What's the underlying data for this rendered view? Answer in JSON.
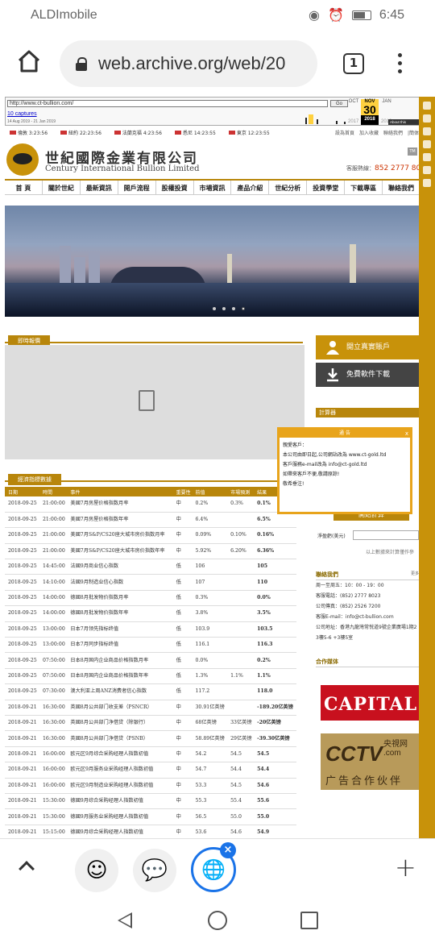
{
  "status": {
    "carrier": "ALDImobile",
    "time": "6:45"
  },
  "browser": {
    "url": "web.archive.org/web/20",
    "tab_count": "1"
  },
  "wayback": {
    "url_value": "http://www.ct-bullion.com/",
    "go": "Go",
    "captures": "10 captures",
    "range": "14 Aug 2019 - 21 Jan 2019",
    "months": [
      "OCT",
      "NOV",
      "JAN"
    ],
    "day": "30",
    "years": [
      "2017",
      "2018",
      "2019"
    ],
    "about": "About this capture"
  },
  "timezones": [
    "倫敦 3:23:56",
    "紐約 22:23:56",
    "法蘭克福 4:23:56",
    "悉尼 14:23:55",
    "東京 12:23:55"
  ],
  "toplinks": "設為首頁　加入收藏　聯絡我們　|簡体",
  "site": {
    "name_cn": "世紀國際金業有限公司",
    "name_en": "Century International Bullion Limited",
    "hotline_label": "客服熱線：",
    "hotline": "852 2777 8023",
    "tm": "TM"
  },
  "nav": [
    "首 頁",
    "關於世紀",
    "最新資訊",
    "開戶流程",
    "股權投資",
    "市場資訊",
    "產品介紹",
    "世紀分析",
    "投資學堂",
    "下載專區",
    "聯絡我們"
  ],
  "quotes_title": "即時報價",
  "buttons": {
    "open_account": "開立真實賬戶",
    "download": "免費軟件下載"
  },
  "calculator_title": "計算器",
  "econ_title": "經濟指標數據",
  "table": {
    "headers": [
      "日期",
      "時間",
      "事件",
      "重要性",
      "前值",
      "市場預測",
      "結果"
    ],
    "rows": [
      [
        "2018-09-25",
        "21:00:00",
        "美國7月房屋价格指数月率",
        "中",
        "0.2%",
        "0.3%",
        "0.1%"
      ],
      [
        "2018-09-25",
        "21:00:00",
        "美國7月房屋价格指数年率",
        "中",
        "6.4%",
        "",
        "6.5%"
      ],
      [
        "2018-09-25",
        "21:00:00",
        "美國7月S&P/CS20座大城市房价指数月率",
        "中",
        "0.09%",
        "0.10%",
        "0.16%"
      ],
      [
        "2018-09-25",
        "21:00:00",
        "美國7月S&P/CS20座大城市房价指数年率",
        "中",
        "5.92%",
        "6.20%",
        "6.36%"
      ],
      [
        "2018-09-25",
        "14:45:00",
        "法國9月商业信心指数",
        "低",
        "106",
        "",
        "105"
      ],
      [
        "2018-09-25",
        "14:10:00",
        "法國9月制造业信心指数",
        "低",
        "107",
        "",
        "110"
      ],
      [
        "2018-09-25",
        "14:00:00",
        "德國8月批发物价指数月率",
        "低",
        "0.3%",
        "",
        "0.0%"
      ],
      [
        "2018-09-25",
        "14:00:00",
        "德國8月批发物价指数年率",
        "低",
        "3.8%",
        "",
        "3.5%"
      ],
      [
        "2018-09-25",
        "13:00:00",
        "日本7月领先指标终值",
        "低",
        "103.9",
        "",
        "103.5"
      ],
      [
        "2018-09-25",
        "13:00:00",
        "日本7月同步指标终值",
        "低",
        "116.1",
        "",
        "116.3"
      ],
      [
        "2018-09-25",
        "07:50:00",
        "日本8月国内企业商品价格指数月率",
        "低",
        "0.0%",
        "",
        "0.2%"
      ],
      [
        "2018-09-25",
        "07:50:00",
        "日本8月国内企业商品价格指数年率",
        "低",
        "1.3%",
        "1.1%",
        "1.1%"
      ],
      [
        "2018-09-25",
        "07:30:00",
        "澳大利亚上周ANZ消费者信心指数",
        "低",
        "117.2",
        "",
        "118.0"
      ],
      [
        "2018-09-21",
        "16:30:00",
        "英國8月公共部门收支差（PSNCR）",
        "中",
        "30.91亿英镑",
        "",
        "-189.20亿英镑"
      ],
      [
        "2018-09-21",
        "16:30:00",
        "英國8月公共部门净借贷（除银行）",
        "中",
        "68亿英镑",
        "33亿英镑",
        "-20亿英镑"
      ],
      [
        "2018-09-21",
        "16:30:00",
        "英國8月公共部门净借贷（PSNB）",
        "中",
        "58.89亿英镑",
        "29亿英镑",
        "-39.30亿英镑"
      ],
      [
        "2018-09-21",
        "16:00:00",
        "欧元区9月综合采购经理人指数初值",
        "中",
        "54.2",
        "54.5",
        "54.5"
      ],
      [
        "2018-09-21",
        "16:00:00",
        "欧元区9月服务业采购经理人指数初值",
        "中",
        "54.7",
        "54.4",
        "54.4"
      ],
      [
        "2018-09-21",
        "16:00:00",
        "欧元区9月制造业采购经理人指数初值",
        "中",
        "53.3",
        "54.5",
        "54.6"
      ],
      [
        "2018-09-21",
        "15:30:00",
        "德國9月综合采购经理人指数初值",
        "中",
        "55.3",
        "55.4",
        "55.6"
      ],
      [
        "2018-09-21",
        "15:30:00",
        "德國9月服务业采购经理人指数初值",
        "中",
        "56.5",
        "55.0",
        "55.0"
      ],
      [
        "2018-09-21",
        "15:15:00",
        "德國9月综合采购经理人指数初值",
        "中",
        "53.6",
        "54.6",
        "54.9"
      ]
    ]
  },
  "popup": {
    "title": "通 告",
    "close": "x",
    "greeting": "親愛客戶：",
    "line1": "本公司由即日起,公司網站改為 www.ct-gold.ltd",
    "line2": "客戶服務e-mail改為 info@ct-gold.ltd",
    "line3": "如帶來客戶不便,敬請原諒!",
    "line4": "敬希垂注!"
  },
  "calc": {
    "button": "開始計算",
    "net_label": "淨盈虧(美元)",
    "hint": "以上數據來計算僅作參"
  },
  "contact": {
    "title": "聯絡我們",
    "more": "更多",
    "lines": [
      "周一至周五：10：00 - 19：00",
      "客服電話：(852) 2777 8023",
      "公司傳真：(852) 2526 7200",
      "客服E-mail：info@ct-bullion.com",
      "公司地址：香港九龍灣常悅道9號企業廣場1期2",
      "3樓5-6 +3樓5室"
    ]
  },
  "media_title": "合作媒体",
  "capital": "CAPITAL",
  "cctv": {
    "logo": "CCTV",
    "net": "央視网 .com",
    "tag": "广告合作伙伴"
  },
  "bottom_tabs": {
    "emoji": "☺",
    "chat": "💬",
    "active": "🌐",
    "close": "×",
    "add": "+"
  }
}
